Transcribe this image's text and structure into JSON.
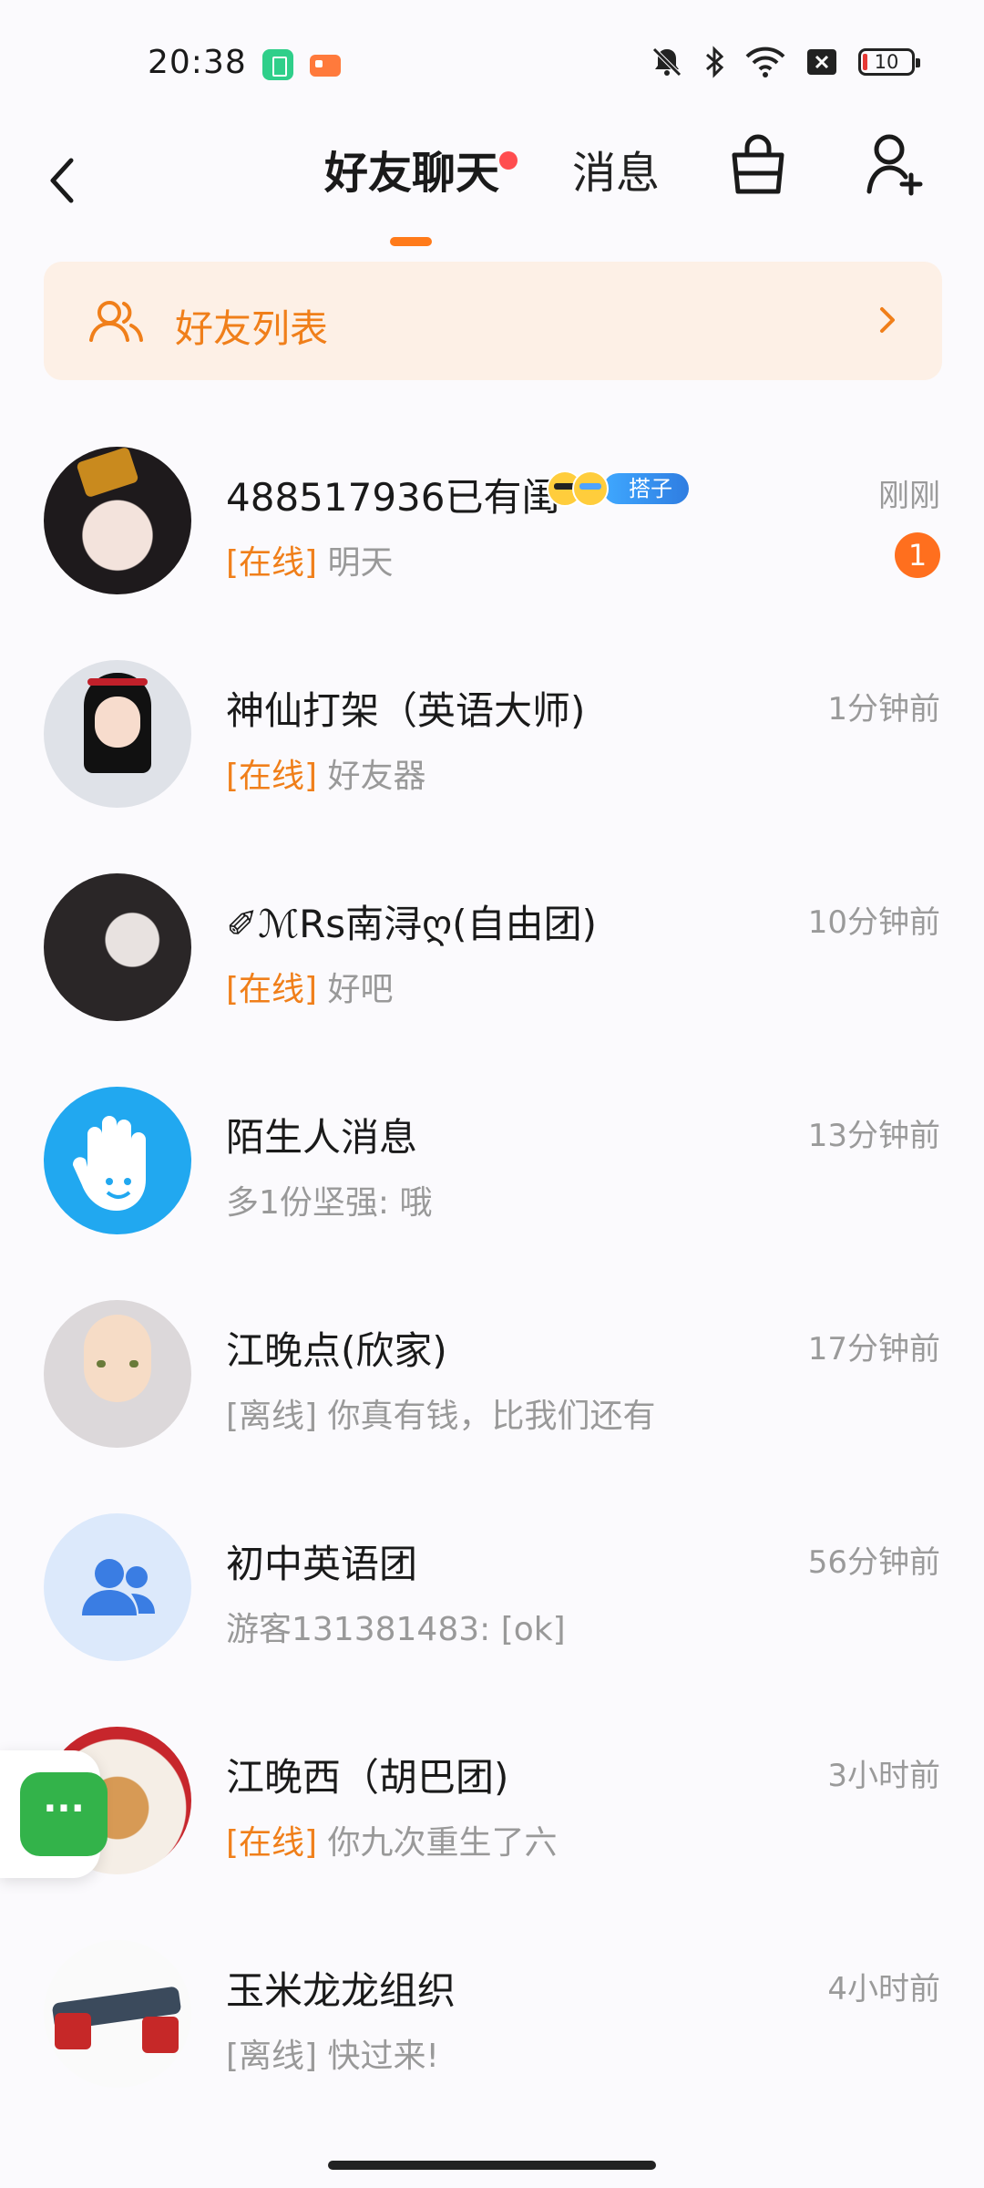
{
  "status_bar": {
    "time": "20:38",
    "battery": "10",
    "icons": [
      "mute-icon",
      "bluetooth-icon",
      "wifi-icon",
      "signal-x-icon",
      "battery-icon"
    ]
  },
  "header": {
    "tabs": [
      {
        "label": "好友聊天",
        "active": true,
        "has_dot": true
      },
      {
        "label": "消息",
        "active": false
      }
    ],
    "icons": [
      "back-icon",
      "clean-basket-icon",
      "add-friend-icon"
    ]
  },
  "banner": {
    "label": "好友列表"
  },
  "chats": [
    {
      "name": "488517936已有闺",
      "status": "[在线]",
      "status_type": "online",
      "message": "明天",
      "time": "刚刚",
      "unread": "1",
      "tag": "搭子"
    },
    {
      "name": "神仙打架（英语大师)",
      "status": "[在线]",
      "status_type": "online",
      "message": "好友器",
      "time": "1分钟前"
    },
    {
      "name": "✐ℳRs南浔ღ(自由团)",
      "status": "[在线]",
      "status_type": "online",
      "message": "好吧",
      "time": "10分钟前"
    },
    {
      "name": "陌生人消息",
      "status": "",
      "status_type": "none",
      "message": "多1份坚强: 哦",
      "time": "13分钟前"
    },
    {
      "name": "江晚点(欣家)",
      "status": "[离线]",
      "status_type": "offline",
      "message": "你真有钱，比我们还有",
      "time": "17分钟前"
    },
    {
      "name": "初中英语团",
      "status": "",
      "status_type": "none",
      "message": "游客131381483: [ok]",
      "time": "56分钟前"
    },
    {
      "name": "江晚西（胡巴团)",
      "status": "[在线]",
      "status_type": "online",
      "message": "你九次重生了六",
      "time": "3小时前"
    },
    {
      "name": "玉米龙龙组织",
      "status": "[离线]",
      "status_type": "offline",
      "message": "快过来!",
      "time": "4小时前"
    }
  ],
  "float_button": {
    "label": "···"
  },
  "colors": {
    "accent": "#f07f1a",
    "unread": "#ff6f1e",
    "banner_bg": "#fdf0e6",
    "float_green": "#33b34a"
  }
}
